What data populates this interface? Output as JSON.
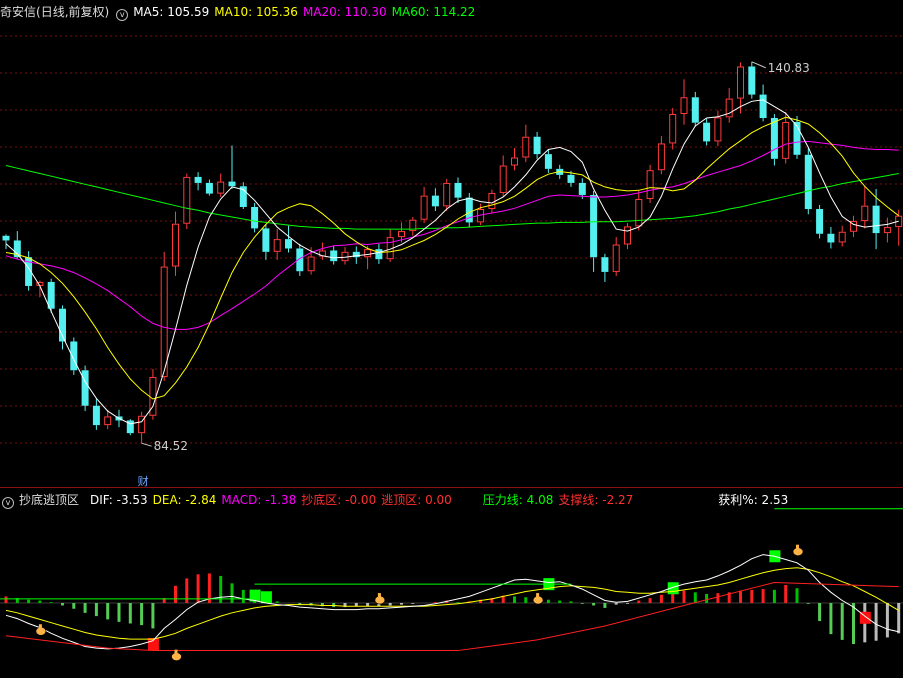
{
  "header": {
    "stock_name": "奇安信",
    "period": "(日线,前复权)",
    "ma_labels": [
      {
        "name": "MA5",
        "value": "105.59",
        "color": "#ffffff"
      },
      {
        "name": "MA10",
        "value": "105.36",
        "color": "#ffff00"
      },
      {
        "name": "MA20",
        "value": "110.30",
        "color": "#ff00ff"
      },
      {
        "name": "MA60",
        "value": "114.22",
        "color": "#00ff00"
      }
    ]
  },
  "macd_header": {
    "indicator_name": "抄底逃顶区",
    "items": [
      {
        "label": "DIF:",
        "value": "-3.53",
        "color": "#ffffff"
      },
      {
        "label": "DEA:",
        "value": "-2.84",
        "color": "#ffff00"
      },
      {
        "label": "MACD:",
        "value": "-1.38",
        "color": "#ff00ff"
      },
      {
        "label": "抄底区:",
        "value": "-0.00",
        "color": "#ff3030"
      },
      {
        "label": "逃顶区:",
        "value": "0.00",
        "color": "#ff3030"
      },
      {
        "label": "压力线:",
        "value": "4.08",
        "color": "#00ff00"
      },
      {
        "label": "支撑线:",
        "value": "-2.27",
        "color": "#ff3030"
      },
      {
        "label": "获利%:",
        "value": "2.53",
        "color": "#ffffff"
      }
    ]
  },
  "annotations": {
    "high_label": "140.83",
    "low_label": "84.52",
    "event_tag": "财"
  },
  "chart_data": [
    {
      "type": "candlestick",
      "title": "",
      "ylim": [
        79,
        147
      ],
      "grid": true,
      "candles": [
        [
          115.5,
          115.7,
          113.5,
          114.8
        ],
        [
          114.8,
          116.2,
          112.1,
          112.3
        ],
        [
          112.3,
          113.2,
          107.3,
          108.0
        ],
        [
          108.0,
          108.8,
          106.3,
          108.6
        ],
        [
          108.6,
          109.1,
          104.0,
          104.6
        ],
        [
          104.6,
          105.1,
          98.5,
          99.7
        ],
        [
          99.7,
          100.3,
          94.7,
          95.4
        ],
        [
          95.4,
          96.1,
          89.3,
          90.1
        ],
        [
          90.1,
          91.2,
          86.5,
          87.2
        ],
        [
          87.2,
          89.5,
          86.6,
          88.5
        ],
        [
          88.5,
          89.5,
          86.9,
          87.9
        ],
        [
          87.9,
          88.1,
          85.7,
          86.0
        ],
        [
          86.0,
          89.2,
          84.5,
          88.6
        ],
        [
          88.6,
          95.6,
          88.0,
          94.4
        ],
        [
          94.4,
          113.1,
          93.8,
          110.9
        ],
        [
          110.9,
          119.1,
          109.5,
          117.3
        ],
        [
          117.3,
          124.8,
          116.5,
          124.3
        ],
        [
          124.3,
          125.0,
          122.3,
          123.4
        ],
        [
          123.4,
          123.9,
          121.5,
          121.8
        ],
        [
          121.8,
          124.8,
          121.3,
          123.6
        ],
        [
          123.6,
          129.0,
          122.5,
          122.9
        ],
        [
          122.9,
          123.5,
          119.5,
          119.8
        ],
        [
          119.8,
          120.4,
          116.0,
          116.6
        ],
        [
          116.6,
          117.2,
          111.9,
          113.1
        ],
        [
          113.1,
          116.5,
          111.9,
          115.0
        ],
        [
          115.0,
          117.0,
          113.0,
          113.6
        ],
        [
          113.6,
          114.3,
          109.5,
          110.2
        ],
        [
          110.2,
          113.8,
          109.7,
          112.4
        ],
        [
          112.4,
          114.5,
          111.9,
          113.3
        ],
        [
          113.3,
          114.0,
          111.2,
          111.7
        ],
        [
          111.7,
          113.8,
          111.2,
          113.1
        ],
        [
          113.1,
          113.9,
          111.3,
          112.3
        ],
        [
          112.3,
          114.0,
          110.5,
          113.5
        ],
        [
          113.5,
          114.3,
          111.3,
          112.0
        ],
        [
          112.0,
          116.5,
          111.6,
          115.3
        ],
        [
          115.3,
          117.5,
          114.5,
          116.2
        ],
        [
          116.2,
          118.3,
          115.5,
          117.9
        ],
        [
          117.9,
          122.8,
          117.4,
          121.5
        ],
        [
          121.5,
          122.6,
          119.2,
          119.9
        ],
        [
          119.9,
          124.0,
          119.2,
          123.4
        ],
        [
          123.4,
          124.2,
          120.4,
          121.2
        ],
        [
          121.2,
          121.9,
          116.8,
          117.5
        ],
        [
          117.5,
          120.3,
          117.1,
          119.5
        ],
        [
          119.5,
          122.4,
          118.9,
          121.9
        ],
        [
          121.9,
          127.5,
          121.4,
          126.0
        ],
        [
          126.0,
          128.6,
          125.3,
          127.2
        ],
        [
          127.2,
          132.1,
          126.5,
          130.3
        ],
        [
          130.3,
          131.0,
          127.0,
          127.7
        ],
        [
          127.7,
          128.4,
          124.9,
          125.5
        ],
        [
          125.5,
          126.1,
          124.0,
          124.6
        ],
        [
          124.6,
          125.2,
          122.8,
          123.4
        ],
        [
          123.4,
          124.1,
          121.0,
          121.6
        ],
        [
          121.6,
          122.2,
          110.1,
          112.3
        ],
        [
          112.3,
          112.8,
          108.6,
          110.1
        ],
        [
          110.1,
          115.3,
          109.5,
          114.2
        ],
        [
          114.2,
          117.4,
          113.5,
          116.9
        ],
        [
          116.9,
          122.2,
          116.3,
          121.0
        ],
        [
          121.0,
          126.1,
          120.4,
          125.3
        ],
        [
          125.3,
          130.4,
          124.7,
          129.3
        ],
        [
          129.3,
          134.6,
          128.4,
          133.7
        ],
        [
          133.7,
          138.9,
          132.1,
          136.2
        ],
        [
          136.2,
          137.0,
          131.8,
          132.4
        ],
        [
          132.4,
          133.0,
          129.0,
          129.6
        ],
        [
          129.6,
          134.2,
          128.9,
          133.2
        ],
        [
          133.2,
          137.6,
          132.4,
          136.0
        ],
        [
          136.0,
          141.4,
          133.8,
          140.8
        ],
        [
          140.8,
          141.5,
          136.0,
          136.6
        ],
        [
          136.6,
          138.1,
          132.6,
          133.1
        ],
        [
          133.1,
          133.7,
          126.0,
          127.0
        ],
        [
          127.0,
          134.0,
          126.3,
          132.5
        ],
        [
          132.5,
          133.4,
          127.0,
          127.6
        ],
        [
          127.6,
          128.6,
          118.7,
          119.5
        ],
        [
          119.5,
          120.1,
          115.1,
          115.8
        ],
        [
          115.8,
          116.8,
          113.6,
          114.5
        ],
        [
          114.5,
          117.0,
          113.9,
          116.1
        ],
        [
          116.1,
          118.5,
          115.3,
          117.7
        ],
        [
          117.7,
          123.0,
          116.6,
          120.0
        ],
        [
          120.0,
          122.5,
          113.5,
          115.9
        ],
        [
          115.9,
          118.2,
          114.5,
          116.8
        ],
        [
          116.8,
          119.4,
          114.0,
          118.5
        ]
      ],
      "ma5": [
        114.3,
        112.8,
        110.7,
        108.0,
        104.2,
        100.5,
        97.0,
        93.7,
        91.2,
        89.3,
        88.2,
        87.4,
        87.7,
        90.0,
        95.3,
        101.5,
        108.1,
        113.8,
        118.3,
        121.0,
        122.8,
        122.4,
        120.8,
        118.8,
        116.8,
        115.4,
        114.1,
        113.2,
        112.5,
        112.2,
        112.3,
        112.5,
        112.7,
        113.0,
        113.5,
        114.2,
        115.2,
        116.5,
        117.8,
        119.5,
        120.7,
        121.1,
        120.6,
        120.4,
        121.3,
        122.8,
        124.6,
        126.8,
        128.4,
        128.7,
        128.1,
        126.5,
        122.5,
        119.3,
        116.5,
        116.2,
        116.8,
        118.3,
        121.4,
        125.5,
        129.2,
        131.9,
        133.1,
        133.3,
        133.8,
        134.8,
        135.6,
        135.8,
        134.8,
        133.8,
        131.9,
        128.7,
        124.9,
        121.3,
        118.4,
        117.2,
        116.8,
        117.0,
        117.2,
        117.7
      ],
      "ma10": [
        113.0,
        112.7,
        112.2,
        111.3,
        110.0,
        108.4,
        106.4,
        104.1,
        101.6,
        98.8,
        96.3,
        94.1,
        92.4,
        91.1,
        91.6,
        93.5,
        95.9,
        98.8,
        102.3,
        106.2,
        110.0,
        113.0,
        115.3,
        117.2,
        118.9,
        119.7,
        120.3,
        120.0,
        118.8,
        117.4,
        115.8,
        114.6,
        113.6,
        113.0,
        113.1,
        113.4,
        114.1,
        114.8,
        115.7,
        116.8,
        118.0,
        119.0,
        119.7,
        120.1,
        120.6,
        121.4,
        122.6,
        123.9,
        124.7,
        125.1,
        124.9,
        124.6,
        123.5,
        122.8,
        122.4,
        122.2,
        122.3,
        122.7,
        122.6,
        122.2,
        122.5,
        123.8,
        125.5,
        127.0,
        128.5,
        129.7,
        130.9,
        131.8,
        132.5,
        133.2,
        132.8,
        132.2,
        130.9,
        129.3,
        127.4,
        124.9,
        122.9,
        121.2,
        119.8,
        118.5
      ],
      "ma20": [
        112.5,
        112.0,
        111.6,
        111.3,
        111.0,
        110.6,
        110.0,
        109.2,
        108.3,
        107.3,
        106.1,
        104.9,
        103.5,
        102.4,
        101.8,
        101.5,
        101.5,
        101.8,
        102.5,
        103.6,
        104.6,
        105.7,
        106.8,
        108.0,
        109.5,
        110.8,
        112.1,
        113.0,
        113.6,
        114.0,
        114.1,
        114.3,
        114.2,
        114.4,
        114.5,
        114.9,
        115.3,
        115.7,
        116.3,
        117.0,
        117.6,
        118.2,
        118.6,
        118.9,
        119.2,
        119.6,
        120.2,
        120.8,
        121.4,
        121.6,
        121.5,
        121.4,
        121.3,
        121.3,
        121.4,
        121.6,
        121.9,
        122.3,
        122.6,
        122.8,
        123.3,
        123.9,
        124.5,
        125.0,
        125.5,
        126.0,
        126.7,
        127.5,
        128.4,
        129.2,
        129.5,
        129.6,
        129.4,
        129.2,
        129.0,
        128.7,
        128.5,
        128.4,
        128.4,
        128.3
      ],
      "ma60": [
        126.0,
        125.6,
        125.2,
        124.8,
        124.4,
        124.0,
        123.6,
        123.2,
        122.8,
        122.4,
        122.0,
        121.6,
        121.2,
        120.8,
        120.4,
        120.0,
        119.6,
        119.3,
        118.9,
        118.6,
        118.3,
        118.0,
        117.7,
        117.5,
        117.3,
        117.1,
        116.9,
        116.8,
        116.7,
        116.6,
        116.6,
        116.5,
        116.5,
        116.5,
        116.5,
        116.5,
        116.5,
        116.6,
        116.6,
        116.7,
        116.7,
        116.8,
        116.9,
        117.0,
        117.1,
        117.2,
        117.3,
        117.4,
        117.4,
        117.5,
        117.5,
        117.5,
        117.6,
        117.6,
        117.6,
        117.7,
        117.8,
        117.9,
        118.0,
        118.1,
        118.3,
        118.5,
        118.8,
        119.1,
        119.5,
        119.8,
        120.2,
        120.6,
        121.0,
        121.4,
        121.8,
        122.2,
        122.6,
        122.9,
        123.3,
        123.6,
        123.9,
        124.2,
        124.5,
        124.8
      ]
    },
    {
      "type": "bar",
      "title": "",
      "ylim": [
        -9,
        9
      ],
      "macd": [
        0.8,
        0.6,
        0.4,
        0.3,
        0.1,
        -0.3,
        -0.7,
        -1.2,
        -1.6,
        -2.0,
        -2.3,
        -2.5,
        -2.7,
        -3.1,
        0.6,
        2.1,
        3.0,
        3.5,
        3.6,
        3.3,
        2.4,
        1.6,
        0.9,
        0.5,
        0.2,
        0.0,
        -0.2,
        -0.3,
        -0.4,
        -0.5,
        -0.5,
        -0.4,
        -0.4,
        -0.4,
        -0.3,
        -0.2,
        -0.1,
        0.0,
        0.1,
        0.3,
        0.1,
        0.2,
        0.4,
        0.6,
        0.9,
        0.8,
        0.7,
        0.5,
        0.4,
        0.3,
        0.2,
        -0.1,
        -0.3,
        -0.6,
        -0.2,
        -0.1,
        0.3,
        0.6,
        1.0,
        1.3,
        1.5,
        1.3,
        1.1,
        1.2,
        1.3,
        1.5,
        1.6,
        1.7,
        1.6,
        2.2,
        1.8,
        -0.1,
        -2.2,
        -3.8,
        -4.5,
        -5.0,
        -4.8,
        -4.6,
        -4.2,
        -3.7
      ],
      "dif": [
        -1.5,
        -1.9,
        -2.5,
        -3.0,
        -3.7,
        -4.3,
        -4.8,
        -5.3,
        -5.5,
        -5.6,
        -5.5,
        -5.3,
        -5.0,
        -4.6,
        -3.1,
        -2.0,
        -0.8,
        0.1,
        0.5,
        0.7,
        0.8,
        0.5,
        0.3,
        0.0,
        -0.2,
        -0.3,
        -0.5,
        -0.6,
        -0.7,
        -0.8,
        -0.8,
        -0.8,
        -0.7,
        -0.7,
        -0.6,
        -0.5,
        -0.4,
        -0.3,
        -0.1,
        0.2,
        0.5,
        0.8,
        1.3,
        1.8,
        2.3,
        2.8,
        2.9,
        2.7,
        2.5,
        2.6,
        2.2,
        1.7,
        1.0,
        0.3,
        0.1,
        0.2,
        0.6,
        1.0,
        1.4,
        1.9,
        2.3,
        2.6,
        2.8,
        3.3,
        3.9,
        4.6,
        5.4,
        5.9,
        5.7,
        5.3,
        4.9,
        4.0,
        2.5,
        1.3,
        0.3,
        -0.5,
        -1.6,
        -2.6,
        -3.2,
        -3.5
      ],
      "dea": [
        -0.9,
        -1.2,
        -1.6,
        -2.0,
        -2.4,
        -2.8,
        -3.2,
        -3.6,
        -3.9,
        -4.1,
        -4.3,
        -4.4,
        -4.4,
        -4.4,
        -4.1,
        -3.7,
        -3.1,
        -2.6,
        -2.1,
        -1.6,
        -1.2,
        -0.9,
        -0.6,
        -0.4,
        -0.3,
        -0.2,
        -0.2,
        -0.2,
        -0.3,
        -0.3,
        -0.4,
        -0.4,
        -0.4,
        -0.4,
        -0.4,
        -0.4,
        -0.4,
        -0.4,
        -0.3,
        -0.2,
        -0.1,
        0.1,
        0.3,
        0.5,
        0.8,
        1.1,
        1.4,
        1.6,
        1.8,
        2.0,
        2.1,
        2.0,
        1.9,
        1.7,
        1.4,
        1.3,
        1.2,
        1.2,
        1.3,
        1.4,
        1.6,
        1.8,
        2.0,
        2.2,
        2.5,
        2.9,
        3.3,
        3.7,
        4.0,
        4.2,
        4.3,
        4.1,
        3.7,
        3.2,
        2.6,
        2.1,
        1.4,
        0.7,
        -0.1,
        -0.9
      ]
    }
  ]
}
